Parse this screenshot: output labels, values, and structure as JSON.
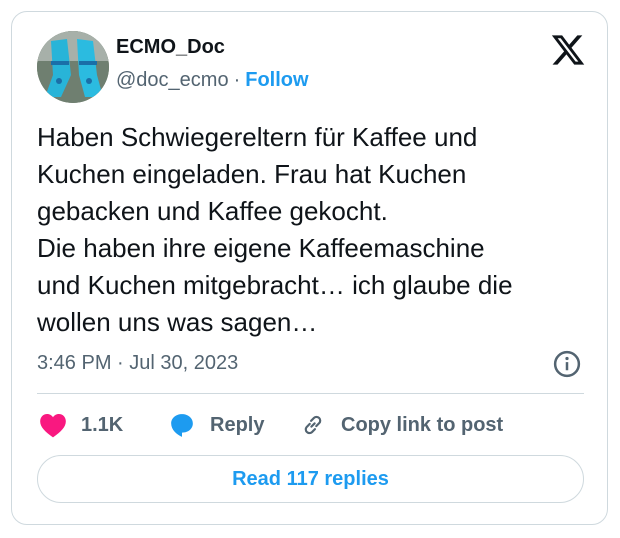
{
  "author": {
    "name": "ECMO_Doc",
    "handle": "@doc_ecmo",
    "separator": "·",
    "follow_label": "Follow",
    "avatar_icon": "avatar-photo-blue-socks"
  },
  "brand": {
    "logo_icon": "x-logo-icon"
  },
  "tweet": {
    "text": "Haben Schwiegereltern für Kaffee und\nKuchen eingeladen. Frau hat Kuchen\ngebacken und Kaffee gekocht.\nDie haben ihre eigene Kaffeemaschine\nund Kuchen mitgebracht… ich glaube die\nwollen uns was sagen…",
    "timestamp": "3:46 PM · Jul 30, 2023"
  },
  "actions": {
    "like_count": "1.1K",
    "reply_label": "Reply",
    "copy_label": "Copy link to post"
  },
  "footer": {
    "read_replies_label": "Read 117 replies"
  },
  "colors": {
    "accent": "#1d9bf0",
    "like": "#f91880",
    "text": "#0f1419",
    "secondary": "#536471",
    "border": "#cfd9de"
  }
}
